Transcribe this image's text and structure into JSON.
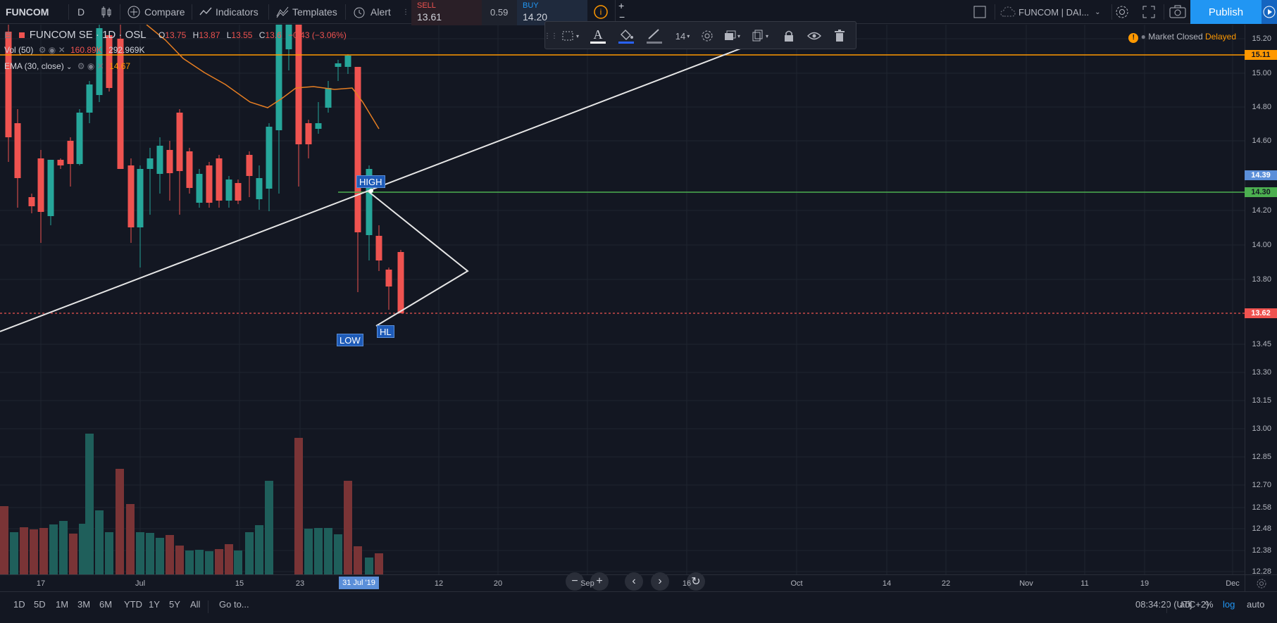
{
  "topbar": {
    "symbol": "FUNCOM",
    "interval": "D",
    "compare": "Compare",
    "indicators": "Indicators",
    "templates": "Templates",
    "alert": "Alert",
    "sell_label": "SELL",
    "sell_price": "13.61",
    "spread": "0.59",
    "buy_label": "BUY",
    "buy_price": "14.20",
    "layout_name": "FUNCOM | DAI...",
    "publish": "Publish"
  },
  "legend": {
    "title": "FUNCOM SE · 1D · OSL",
    "o_label": "O",
    "o_value": "13.75",
    "h_label": "H",
    "h_value": "13.87",
    "l_label": "L",
    "l_value": "13.55",
    "c_label": "C",
    "c_value": "13.6",
    "change": "−0.43 (−3.06%)",
    "vol_label": "Vol (50)",
    "vol_value1": "160.89K",
    "vol_value2": "292.969K",
    "ema_label": "EMA (30, close)",
    "ema_value": "14.67"
  },
  "status": {
    "market": "Market Closed",
    "delayed": "Delayed"
  },
  "drawbar": {
    "font_size": "14"
  },
  "annotations": {
    "high": "HIGH",
    "low": "LOW",
    "hl": "HL"
  },
  "price_axis": {
    "labels": [
      "15.20",
      "15.00",
      "14.80",
      "14.60",
      "14.20",
      "14.00",
      "13.80",
      "13.45",
      "13.30",
      "13.15",
      "13.00",
      "12.85",
      "12.70",
      "12.58",
      "12.48",
      "12.38",
      "12.28"
    ],
    "tag_orange": "15.11",
    "tag_blue": "14.39",
    "tag_green": "14.30",
    "tag_red": "13.62"
  },
  "time_axis": {
    "labels": [
      "17",
      "Jul",
      "15",
      "23",
      "12",
      "20",
      "Sep",
      "16",
      "Oct",
      "14",
      "22",
      "Nov",
      "11",
      "19",
      "Dec"
    ],
    "current": "31 Jul '19"
  },
  "bottombar": {
    "ranges": [
      "1D",
      "5D",
      "1M",
      "3M",
      "6M",
      "YTD",
      "1Y",
      "5Y",
      "All"
    ],
    "goto": "Go to...",
    "clock": "08:34:20 (UTC+2)",
    "adj": "adj",
    "percent": "%",
    "log": "log",
    "auto": "auto"
  },
  "colors": {
    "up": "#26a69a",
    "down": "#ef5350",
    "orange": "#ff9800",
    "green_line": "#4caf50",
    "accent": "#2962ff"
  }
}
